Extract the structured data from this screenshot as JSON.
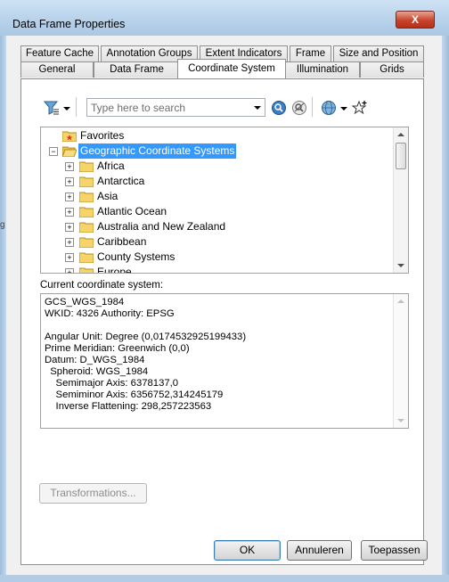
{
  "window": {
    "title": "Data Frame Properties",
    "close_glyph": "X"
  },
  "tabs": {
    "row1": [
      {
        "label": "Feature Cache"
      },
      {
        "label": "Annotation Groups"
      },
      {
        "label": "Extent Indicators"
      },
      {
        "label": "Frame"
      },
      {
        "label": "Size and Position"
      }
    ],
    "row2": [
      {
        "label": "General"
      },
      {
        "label": "Data Frame"
      },
      {
        "label": "Coordinate System",
        "active": true
      },
      {
        "label": "Illumination"
      },
      {
        "label": "Grids"
      }
    ]
  },
  "toolbar": {
    "filter_icon": "filter-icon",
    "search_placeholder": "Type here to search",
    "search_icon": "search-icon",
    "clear_search_icon": "clear-search-icon",
    "globe_icon": "globe-icon",
    "add_favorite_icon": "add-favorite-icon"
  },
  "tree": {
    "items": [
      {
        "label": "Favorites",
        "icon": "favorites-folder-icon",
        "expander": ""
      },
      {
        "label": "Geographic Coordinate Systems",
        "icon": "open-folder-icon",
        "expander": "−",
        "selected": true
      },
      {
        "label": "Africa",
        "icon": "folder-icon",
        "expander": "+"
      },
      {
        "label": "Antarctica",
        "icon": "folder-icon",
        "expander": "+"
      },
      {
        "label": "Asia",
        "icon": "folder-icon",
        "expander": "+"
      },
      {
        "label": "Atlantic Ocean",
        "icon": "folder-icon",
        "expander": "+"
      },
      {
        "label": "Australia and New Zealand",
        "icon": "folder-icon",
        "expander": "+"
      },
      {
        "label": "Caribbean",
        "icon": "folder-icon",
        "expander": "+"
      },
      {
        "label": "County Systems",
        "icon": "folder-icon",
        "expander": "+"
      },
      {
        "label": "Europe",
        "icon": "folder-icon",
        "expander": "+"
      }
    ]
  },
  "current_cs": {
    "label": "Current coordinate system:",
    "lines": [
      "GCS_WGS_1984",
      "WKID: 4326 Authority: EPSG",
      "",
      "Angular Unit: Degree (0,0174532925199433)",
      "Prime Meridian: Greenwich (0,0)",
      "Datum: D_WGS_1984",
      "  Spheroid: WGS_1984",
      "    Semimajor Axis: 6378137,0",
      "    Semiminor Axis: 6356752,314245179",
      "    Inverse Flattening: 298,257223563"
    ]
  },
  "buttons": {
    "transformations": "Transformations...",
    "ok": "OK",
    "cancel": "Annuleren",
    "apply": "Toepassen"
  },
  "colors": {
    "selection": "#3399ff",
    "folder": "#f5d46a",
    "close_button": "#c9432b"
  },
  "left_edge_hint": "g"
}
